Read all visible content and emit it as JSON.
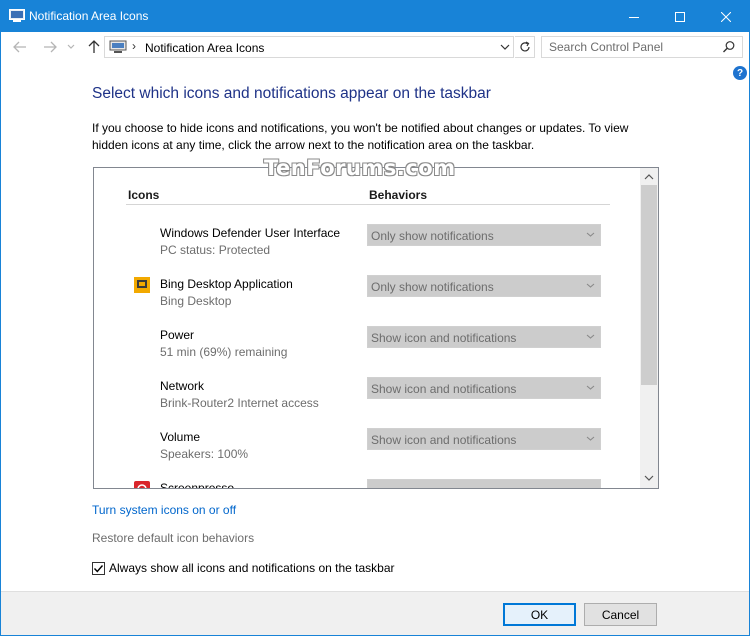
{
  "window": {
    "title": "Notification Area Icons",
    "accent": "#1883d7"
  },
  "nav": {
    "path": "Notification Area Icons",
    "search_placeholder": "Search Control Panel"
  },
  "help_label": "?",
  "heading": "Select which icons and notifications appear on the taskbar",
  "description": "If you choose to hide icons and notifications, you won't be notified about changes or updates. To view hidden icons at any time, click the arrow next to the notification area on the taskbar.",
  "watermark": "TenForums.com",
  "list": {
    "col_icons": "Icons",
    "col_behaviors": "Behaviors",
    "rows": [
      {
        "name": "Windows Defender User Interface",
        "sub": "PC status: Protected",
        "behavior": "Only show notifications",
        "icon": "none"
      },
      {
        "name": "Bing Desktop Application",
        "sub": "Bing Desktop",
        "behavior": "Only show notifications",
        "icon": "bing-desktop-icon"
      },
      {
        "name": "Power",
        "sub": "51 min (69%) remaining",
        "behavior": "Show icon and notifications",
        "icon": "none"
      },
      {
        "name": "Network",
        "sub": "Brink-Router2 Internet access",
        "behavior": "Show icon and notifications",
        "icon": "none"
      },
      {
        "name": "Volume",
        "sub": "Speakers: 100%",
        "behavior": "Show icon and notifications",
        "icon": "none"
      },
      {
        "name": "Screenpresso",
        "sub": "",
        "behavior": "",
        "icon": "screenpresso-icon"
      }
    ]
  },
  "links": {
    "system_icons": "Turn system icons on or off",
    "restore": "Restore default icon behaviors"
  },
  "always_show": {
    "label": "Always show all icons and notifications on the taskbar",
    "checked": true
  },
  "buttons": {
    "ok": "OK",
    "cancel": "Cancel"
  }
}
